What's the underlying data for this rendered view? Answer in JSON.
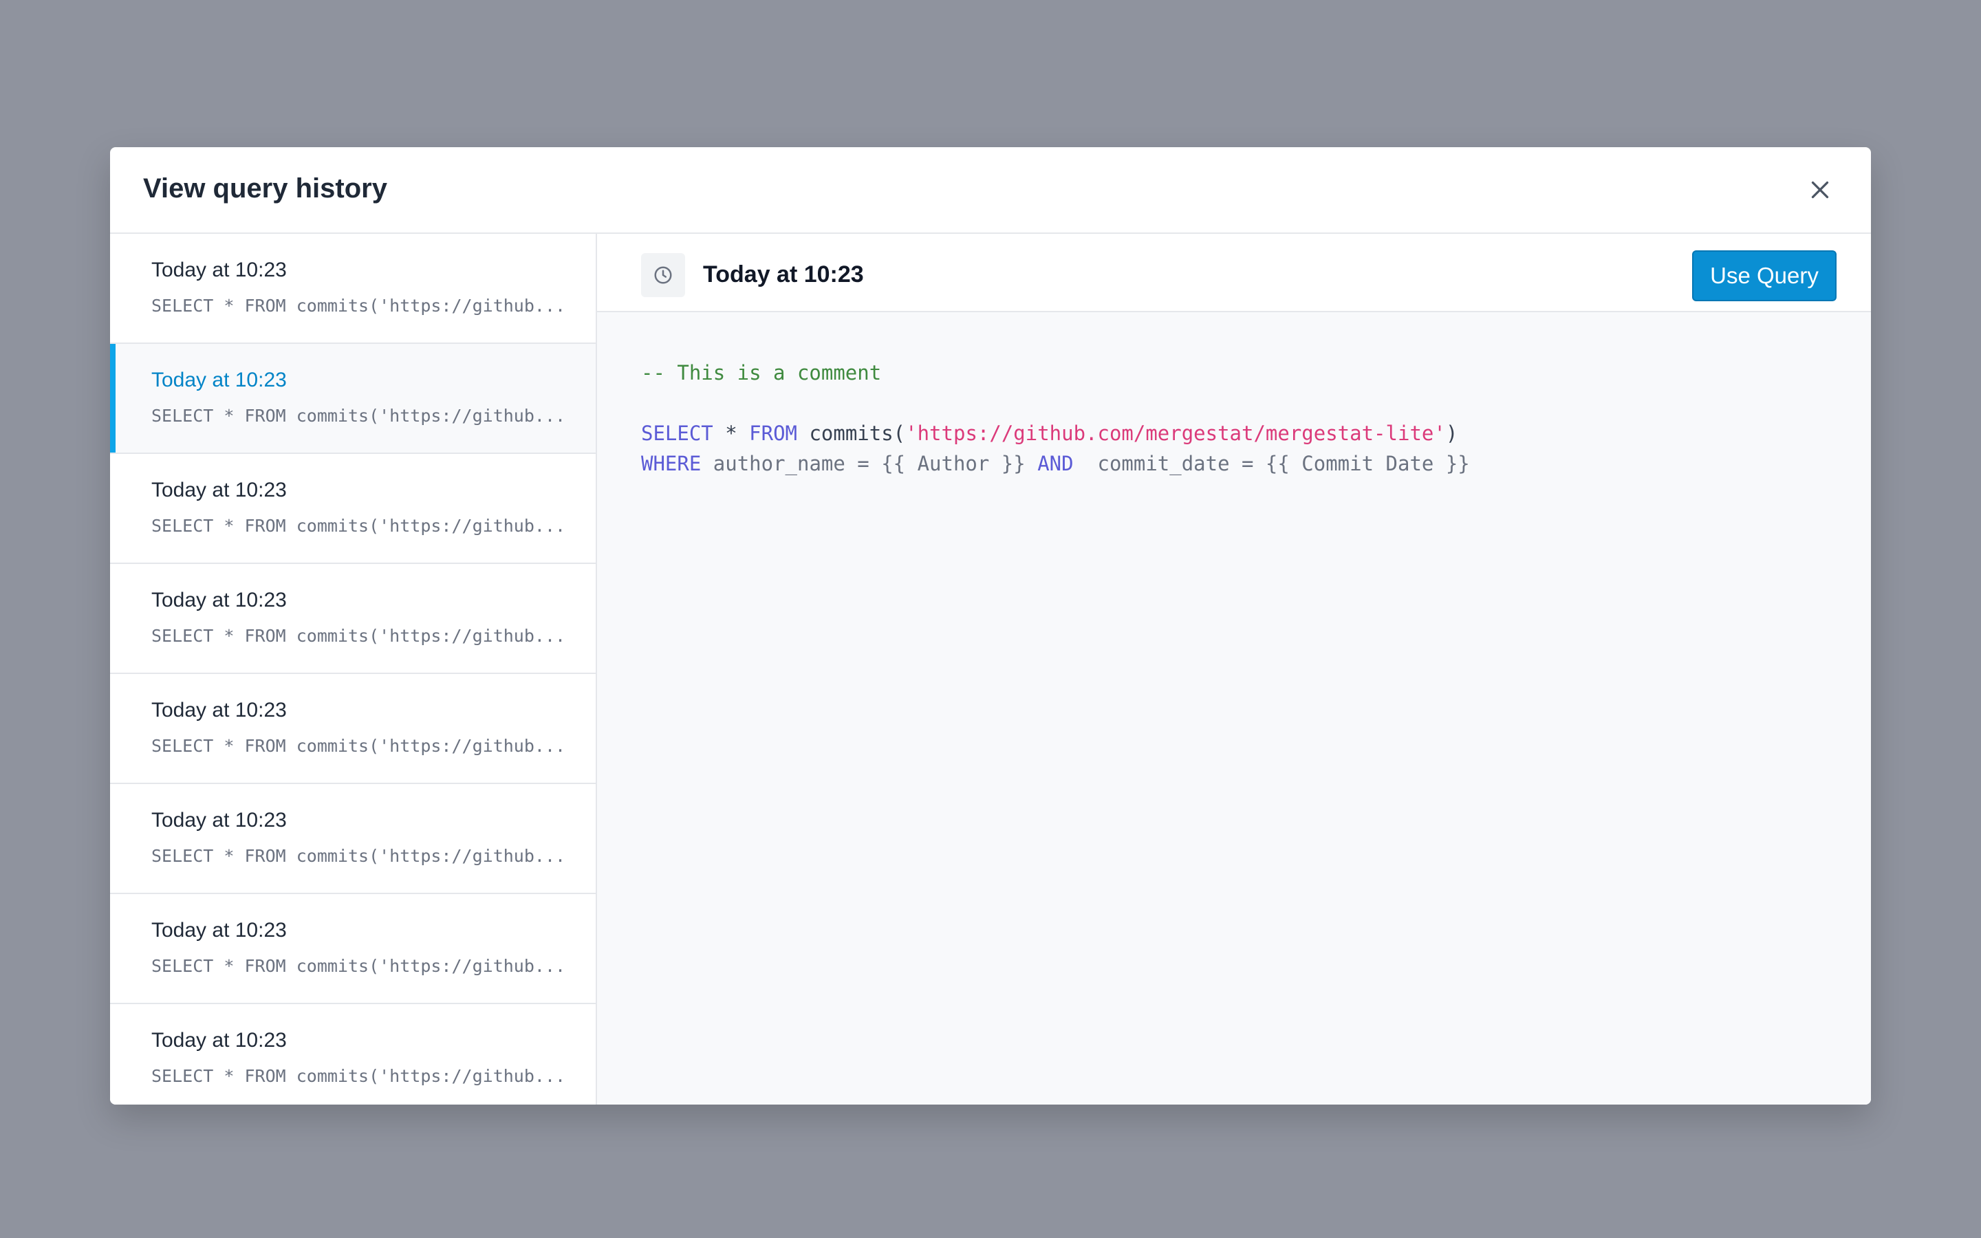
{
  "modal": {
    "title": "View query history",
    "close_icon": "close-icon"
  },
  "history": {
    "items": [
      {
        "time": "Today at 10:23",
        "query": "SELECT * FROM commits('https://github...",
        "active": false
      },
      {
        "time": "Today at 10:23",
        "query": "SELECT * FROM commits('https://github...",
        "active": true
      },
      {
        "time": "Today at 10:23",
        "query": "SELECT * FROM commits('https://github...",
        "active": false
      },
      {
        "time": "Today at 10:23",
        "query": "SELECT * FROM commits('https://github...",
        "active": false
      },
      {
        "time": "Today at 10:23",
        "query": "SELECT * FROM commits('https://github...",
        "active": false
      },
      {
        "time": "Today at 10:23",
        "query": "SELECT * FROM commits('https://github...",
        "active": false
      },
      {
        "time": "Today at 10:23",
        "query": "SELECT * FROM commits('https://github...",
        "active": false
      },
      {
        "time": "Today at 10:23",
        "query": "SELECT * FROM commits('https://github...",
        "active": false
      }
    ]
  },
  "detail": {
    "icon": "clock-icon",
    "title": "Today at 10:23",
    "use_button": "Use Query",
    "code": {
      "comment": "-- This is a comment",
      "line1": {
        "select": "SELECT",
        "star": " * ",
        "from": "FROM",
        "commits_open": " commits(",
        "url": "'https://github.com/mergestat/mergestat-lite'",
        "close": ")"
      },
      "line2": {
        "where": "WHERE",
        "author": " author_name = {{ Author }} ",
        "and": "AND",
        "commit": "  commit_date = {{ Commit Date }}"
      }
    }
  },
  "colors": {
    "accent": "#0ea5e9",
    "button": "#0a8fd3",
    "keyword": "#5b5bd6",
    "string": "#db3a7a",
    "comment": "#3f8a3f",
    "backdrop": "#8f939e"
  }
}
